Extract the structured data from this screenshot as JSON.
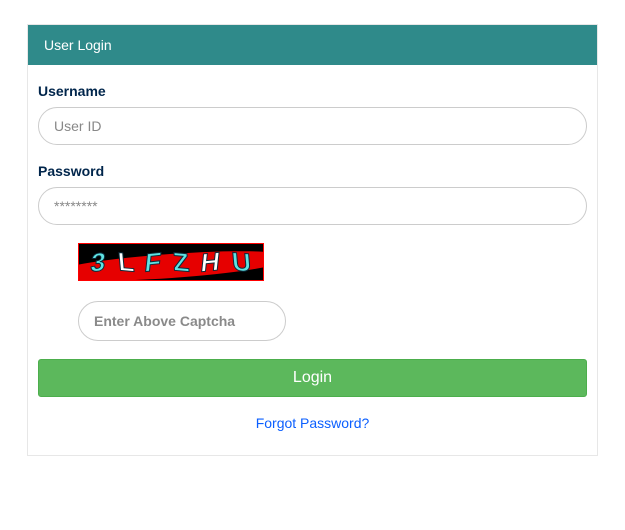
{
  "panel": {
    "title": "User Login"
  },
  "username": {
    "label": "Username",
    "placeholder": "User ID",
    "value": ""
  },
  "password": {
    "label": "Password",
    "placeholder": "********",
    "value": ""
  },
  "captcha": {
    "text": "3LFZHU",
    "chars": [
      "3",
      "L",
      "F",
      "Z",
      "H",
      "U"
    ],
    "placeholder": "Enter Above Captcha",
    "value": ""
  },
  "login": {
    "button_label": "Login"
  },
  "forgot": {
    "label": "Forgot Password?"
  }
}
